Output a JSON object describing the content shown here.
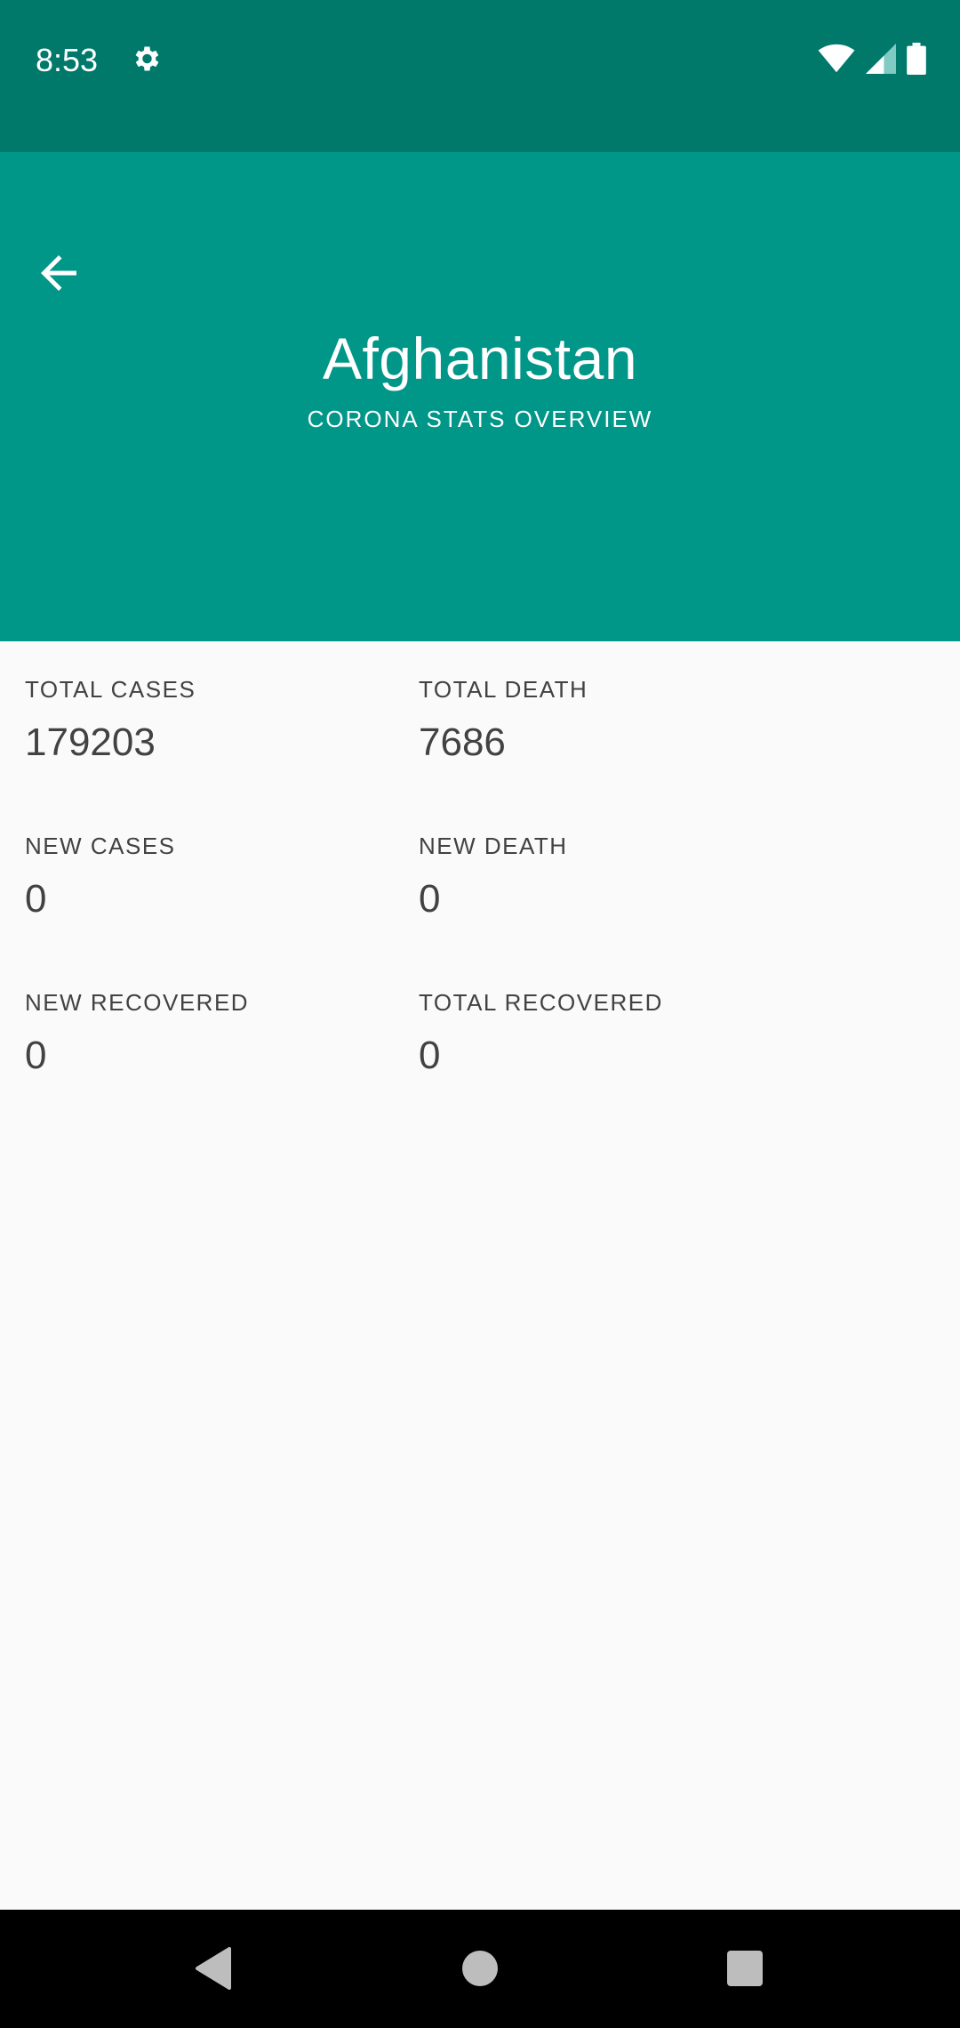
{
  "status_bar": {
    "time": "8:53",
    "icons": [
      "gear-icon",
      "wifi-icon",
      "signal-icon",
      "battery-icon"
    ]
  },
  "header": {
    "title": "Afghanistan",
    "subtitle": "CORONA STATS OVERVIEW",
    "back_icon": "arrow-back-icon",
    "background": "#009688"
  },
  "stats": [
    {
      "label": "TOTAL CASES",
      "value": "179203"
    },
    {
      "label": "TOTAL DEATH",
      "value": "7686"
    },
    {
      "label": "NEW CASES",
      "value": "0"
    },
    {
      "label": "NEW DEATH",
      "value": "0"
    },
    {
      "label": "NEW RECOVERED",
      "value": "0"
    },
    {
      "label": "TOTAL RECOVERED",
      "value": "0"
    }
  ],
  "nav_bar": {
    "buttons": [
      "back-triangle-icon",
      "home-circle-icon",
      "recents-square-icon"
    ]
  },
  "colors": {
    "status_bar": "#00796b",
    "app_bar": "#009688",
    "text_dark": "#424242"
  }
}
